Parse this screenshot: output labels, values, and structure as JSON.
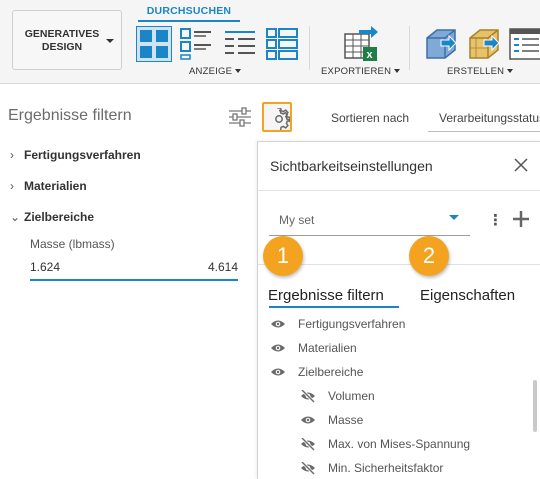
{
  "toolbar": {
    "generative_design": "GENERATIVES\nDESIGN",
    "active_tab": "DURCHSUCHEN",
    "groups": {
      "anzeige": "ANZEIGE",
      "exportieren": "EXPORTIEREN",
      "erstellen": "ERSTELLEN"
    },
    "accent": "#1a86c8"
  },
  "filter_panel": {
    "title": "Ergebnisse filtern",
    "categories": [
      {
        "label": "Fertigungsverfahren",
        "expanded": false
      },
      {
        "label": "Materialien",
        "expanded": false
      },
      {
        "label": "Zielbereiche",
        "expanded": true
      }
    ],
    "mass": {
      "label": "Masse (lbmass)",
      "min": "1.624",
      "max": "4.614"
    }
  },
  "sort": {
    "label": "Sortieren nach",
    "value": "Verarbeitungsstatus"
  },
  "visibility_panel": {
    "title": "Sichtbarkeitseinstellungen",
    "set_placeholder": "My set",
    "badges": [
      "1",
      "2"
    ],
    "badge_color": "#f4a321",
    "tabs": {
      "results": "Ergebnisse filtern",
      "properties": "Eigenschaften"
    },
    "items": [
      {
        "label": "Fertigungsverfahren",
        "visible": true
      },
      {
        "label": "Materialien",
        "visible": true
      },
      {
        "label": "Zielbereiche",
        "visible": true
      },
      {
        "label": "Volumen",
        "visible": false
      },
      {
        "label": "Masse",
        "visible": true
      },
      {
        "label": "Max. von Mises-Spannung",
        "visible": false
      },
      {
        "label": "Min. Sicherheitsfaktor",
        "visible": false
      }
    ]
  }
}
